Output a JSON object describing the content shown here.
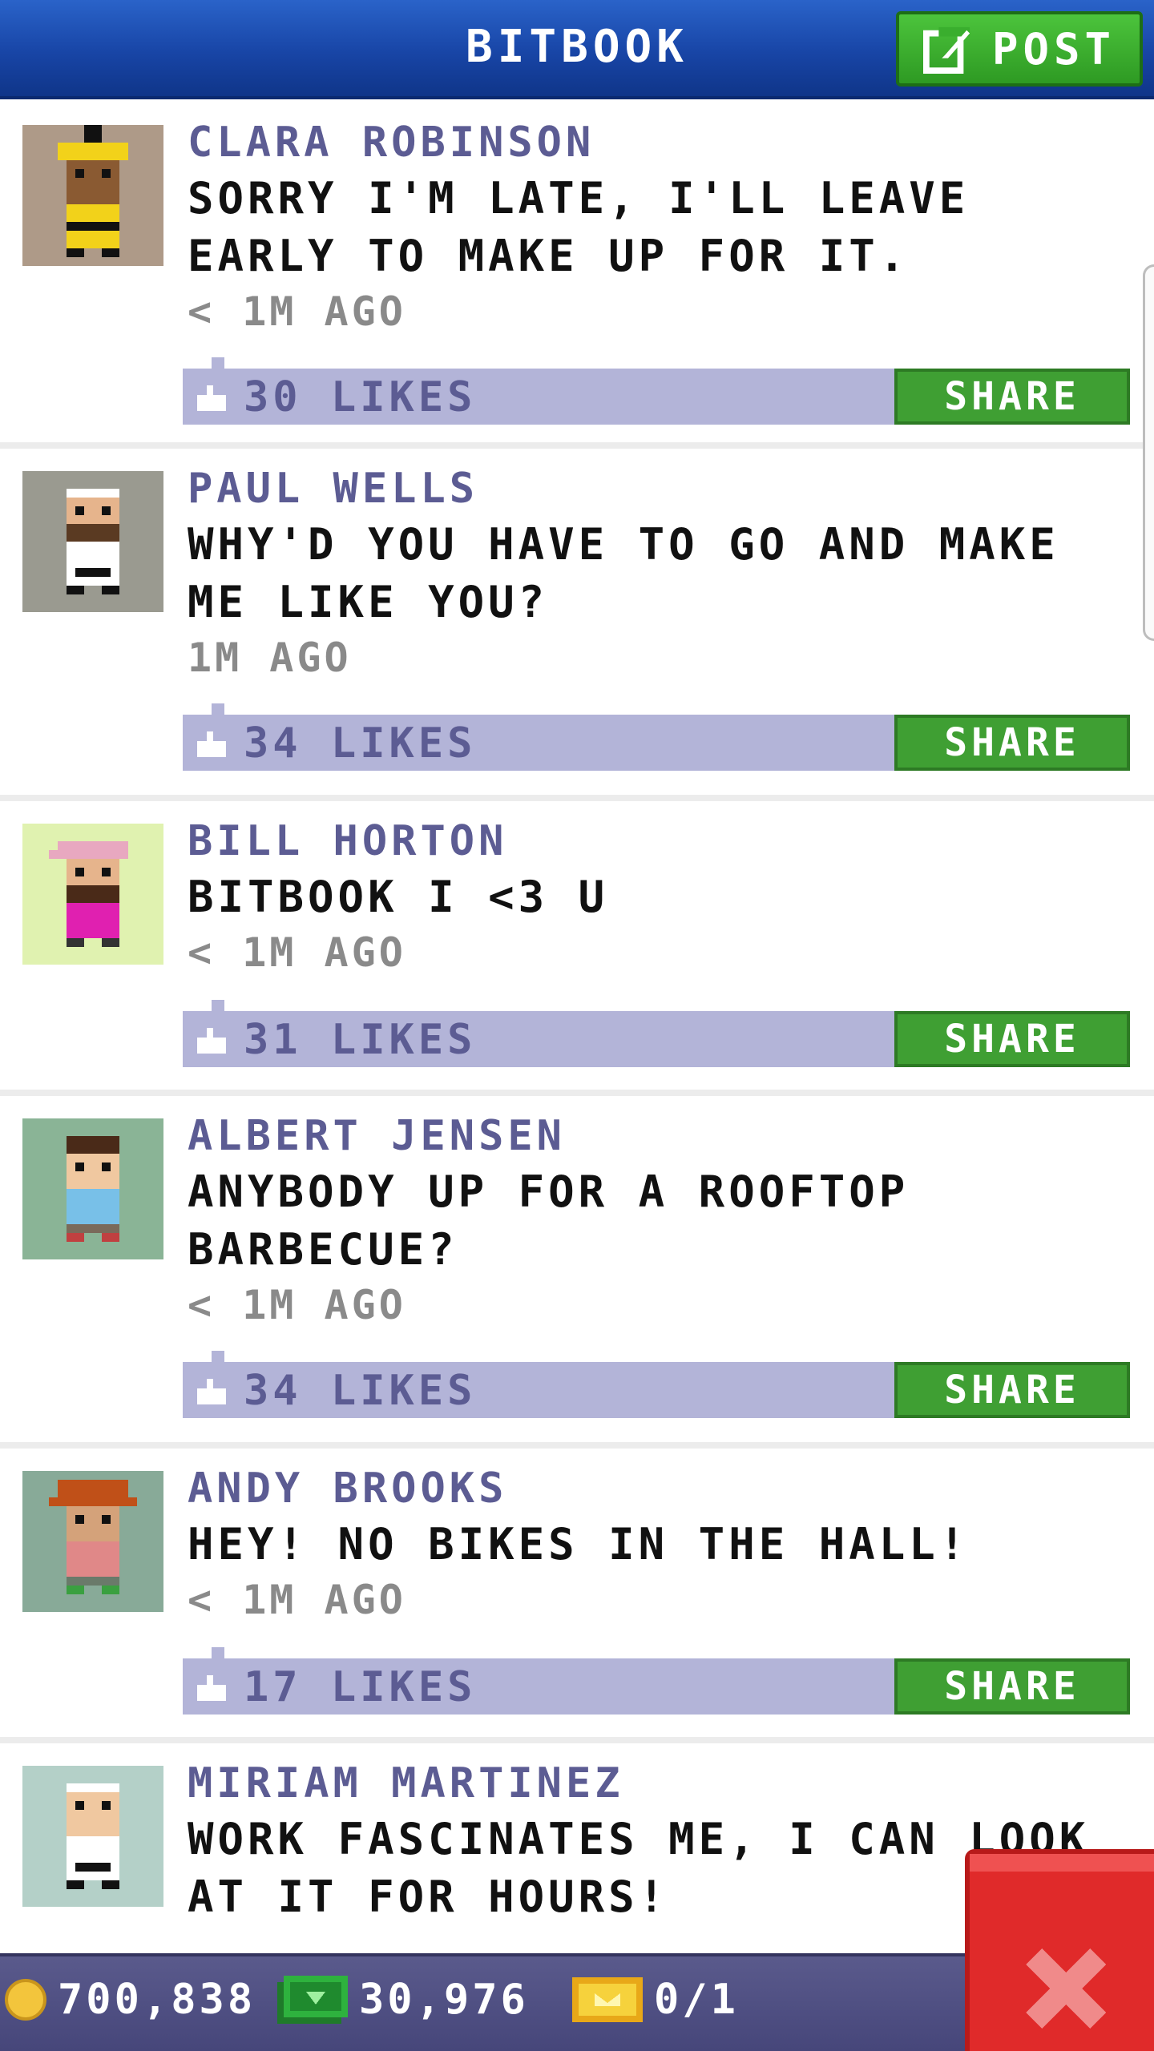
{
  "header": {
    "title": "BITBOOK",
    "post_label": "POST",
    "icon": "edit-icon"
  },
  "posts": [
    {
      "name": "CLARA ROBINSON",
      "text": "SORRY I'M LATE, I'LL LEAVE EARLY TO MAKE UP FOR IT.",
      "time": "< 1M AGO",
      "likes": "30 LIKES",
      "share_label": "SHARE"
    },
    {
      "name": "PAUL WELLS",
      "text": "WHY'D YOU HAVE TO GO AND MAKE ME LIKE YOU?",
      "time": "1M AGO",
      "likes": "34 LIKES",
      "share_label": "SHARE"
    },
    {
      "name": "BILL HORTON",
      "text": "BITBOOK I <3 U",
      "time": "< 1M AGO",
      "likes": "31 LIKES",
      "share_label": "SHARE"
    },
    {
      "name": "ALBERT JENSEN",
      "text": "ANYBODY UP FOR A ROOFTOP BARBECUE?",
      "time": "< 1M AGO",
      "likes": "34 LIKES",
      "share_label": "SHARE"
    },
    {
      "name": "ANDY BROOKS",
      "text": "HEY! NO BIKES IN THE HALL!",
      "time": "< 1M AGO",
      "likes": "17 LIKES",
      "share_label": "SHARE"
    },
    {
      "name": "MIRIAM MARTINEZ",
      "text": "WORK FASCINATES ME, I CAN LOOK AT IT FOR HOURS!",
      "time": "",
      "likes": "",
      "share_label": ""
    }
  ],
  "status": {
    "coins": "700,838",
    "bux": "30,976",
    "tickets": "0/1"
  },
  "colors": {
    "header": "#1845a6",
    "accent_green": "#3f9f33",
    "like_bar": "#b3b4d8",
    "name_text": "#5c5c93",
    "close_red": "#e02a2a"
  }
}
